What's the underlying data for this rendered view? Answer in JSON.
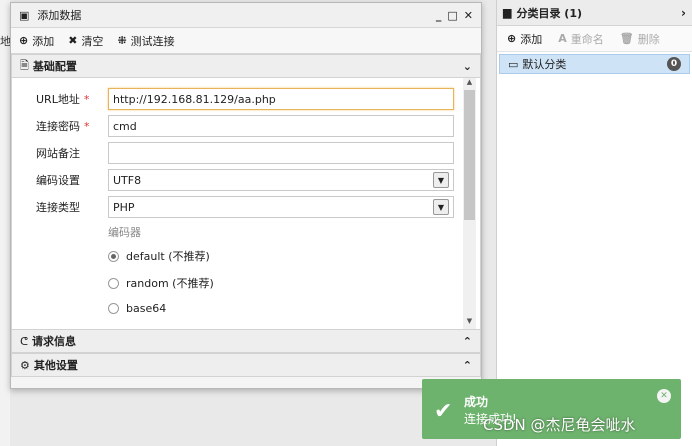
{
  "background": {
    "edge_text": "地"
  },
  "window": {
    "title": "添加数据",
    "controls": {
      "minimize": "_",
      "maximize": "□",
      "close": "✕"
    },
    "toolbar": {
      "add": "添加",
      "clear": "清空",
      "test": "测试连接"
    }
  },
  "sections": {
    "basic": "基础配置",
    "request": "请求信息",
    "other": "其他设置"
  },
  "form": {
    "url_label": "URL地址",
    "url_value": "http://192.168.81.129/aa.php",
    "password_label": "连接密码",
    "password_value": "cmd",
    "note_label": "网站备注",
    "note_value": "",
    "encoding_label": "编码设置",
    "encoding_value": "UTF8",
    "type_label": "连接类型",
    "type_value": "PHP",
    "required_mark": "*",
    "encoder_title": "编码器",
    "encoders": [
      {
        "label": "default (不推荐)",
        "selected": true
      },
      {
        "label": "random (不推荐)",
        "selected": false
      },
      {
        "label": "base64",
        "selected": false
      }
    ]
  },
  "right_panel": {
    "title": "分类目录 (1)",
    "toolbar": {
      "add": "添加",
      "rename": "重命名",
      "delete": "删除"
    },
    "items": [
      {
        "label": "默认分类",
        "count": "0"
      }
    ]
  },
  "toast": {
    "title": "成功",
    "message": "连接成功!",
    "color": "#6db26d"
  },
  "watermark": "CSDN @杰尼龟会呲水"
}
